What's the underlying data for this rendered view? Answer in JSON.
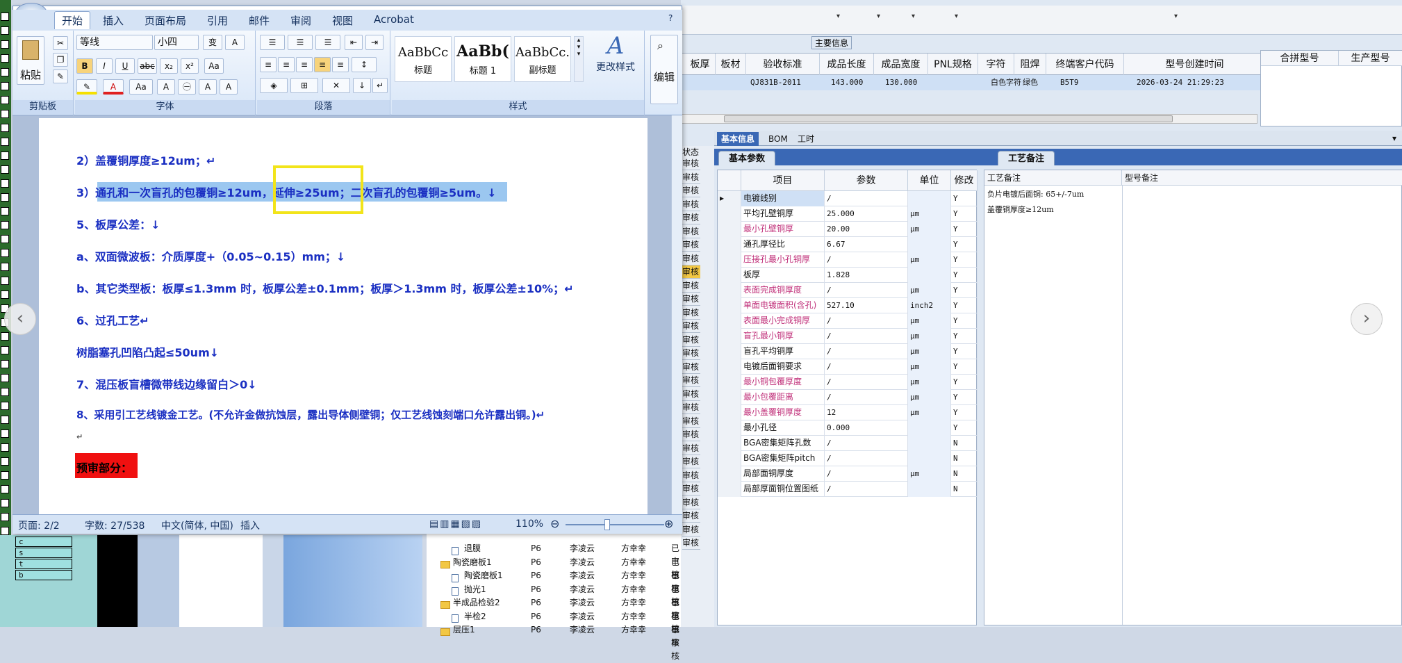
{
  "word": {
    "tabs": [
      "开始",
      "插入",
      "页面布局",
      "引用",
      "邮件",
      "审阅",
      "视图",
      "Acrobat"
    ],
    "font_name": "等线",
    "font_size": "小四",
    "groups": {
      "clipboard": "剪贴板",
      "font": "字体",
      "paragraph": "段落",
      "styles": "样式"
    },
    "paste_label": "粘贴",
    "styles": [
      {
        "preview": "AaBbCc",
        "name": "标题"
      },
      {
        "preview": "AaBb(",
        "name": "标题 1"
      },
      {
        "preview": "AaBbCc.",
        "name": "副标题"
      }
    ],
    "change_styles": "更改样式",
    "edit_label": "编辑",
    "doc_lines": [
      "2）盖覆铜厚度≥12um；↵",
      "3）通孔和一次盲孔的包覆铜≥12um，延伸≥25um；二次盲孔的包覆铜≥5um。↓",
      "5、板厚公差：↓",
      "a、双面微波板：介质厚度+（0.05~0.15）mm；↓",
      "b、其它类型板：板厚≤1.3mm 时，板厚公差±0.1mm；板厚＞1.3mm 时，板厚公差±10%；↵",
      "6、过孔工艺↵",
      "树脂塞孔凹陷凸起≤50um↓",
      "7、混压板盲槽微带线边缘留白＞0↓",
      "8、采用引工艺线镀金工艺。(不允许金做抗蚀层，露出导体侧壁铜；仅工艺线蚀刻端口允许露出铜。)↵",
      "↵"
    ],
    "red_line": "预审部分：",
    "status": {
      "page": "页面: 2/2",
      "words": "字数: 27/538",
      "lang": "中文(简体, 中国)",
      "mode": "插入",
      "zoom": "110%"
    }
  },
  "main_info_label": "主要信息",
  "grid": {
    "headers": [
      "板厚",
      "板材",
      "验收标准",
      "成品长度",
      "成品宽度",
      "PNL规格",
      "字符",
      "阻焊",
      "终端客户代码",
      "型号创建时间"
    ],
    "row": [
      "",
      "",
      "QJ831B-2011",
      "143.000",
      "130.000",
      "",
      "白色字符",
      "绿色",
      "B5T9",
      "2026-03-24 21:29:23"
    ],
    "side_headers": [
      "合拼型号",
      "生产型号"
    ]
  },
  "tabs": [
    "基本信息",
    "BOM",
    "工时"
  ],
  "subtabs": {
    "left": "基本参数",
    "right": "工艺备注"
  },
  "param_table": {
    "headers": [
      "项目",
      "参数",
      "单位",
      "修改"
    ],
    "rows": [
      {
        "item": "电镀线别",
        "value": "/",
        "unit": "",
        "mod": "Y",
        "pink": false
      },
      {
        "item": "平均孔壁铜厚",
        "value": "25.000",
        "unit": "μm",
        "mod": "Y",
        "pink": false
      },
      {
        "item": "最小孔壁铜厚",
        "value": "20.00",
        "unit": "μm",
        "mod": "Y",
        "pink": true
      },
      {
        "item": "通孔厚径比",
        "value": "6.67",
        "unit": "",
        "mod": "Y",
        "pink": false
      },
      {
        "item": "压接孔最小孔铜厚",
        "value": "/",
        "unit": "μm",
        "mod": "Y",
        "pink": true
      },
      {
        "item": "板厚",
        "value": "1.828",
        "unit": "",
        "mod": "Y",
        "pink": false
      },
      {
        "item": "表面完成铜厚度",
        "value": "/",
        "unit": "μm",
        "mod": "Y",
        "pink": true
      },
      {
        "item": "单面电镀面积(含孔)",
        "value": "527.10",
        "unit": "inch2",
        "mod": "Y",
        "pink": true
      },
      {
        "item": "表面最小完成铜厚",
        "value": "/",
        "unit": "μm",
        "mod": "Y",
        "pink": true
      },
      {
        "item": "盲孔最小铜厚",
        "value": "/",
        "unit": "μm",
        "mod": "Y",
        "pink": true
      },
      {
        "item": "盲孔平均铜厚",
        "value": "/",
        "unit": "μm",
        "mod": "Y",
        "pink": false
      },
      {
        "item": "电镀后面铜要求",
        "value": "/",
        "unit": "μm",
        "mod": "Y",
        "pink": false
      },
      {
        "item": "最小铜包覆厚度",
        "value": "/",
        "unit": "μm",
        "mod": "Y",
        "pink": true
      },
      {
        "item": "最小包覆距离",
        "value": "/",
        "unit": "μm",
        "mod": "Y",
        "pink": true
      },
      {
        "item": "最小盖覆铜厚度",
        "value": "12",
        "unit": "μm",
        "mod": "Y",
        "pink": true
      },
      {
        "item": "最小孔径",
        "value": "0.000",
        "unit": "",
        "mod": "Y",
        "pink": false
      },
      {
        "item": "BGA密集矩阵孔数",
        "value": "/",
        "unit": "",
        "mod": "N",
        "pink": false
      },
      {
        "item": "BGA密集矩阵pitch",
        "value": "/",
        "unit": "",
        "mod": "N",
        "pink": false
      },
      {
        "item": "局部面铜厚度",
        "value": "/",
        "unit": "μm",
        "mod": "N",
        "pink": false
      },
      {
        "item": "局部厚面铜位置图纸",
        "value": "/",
        "unit": "",
        "mod": "N",
        "pink": false
      }
    ]
  },
  "notes": {
    "headers": [
      "工艺备注",
      "型号备注"
    ],
    "lines": [
      "负片电镀后面铜: 65+/-7um",
      "盖覆铜厚度≥12um"
    ]
  },
  "mid_col_label": "状态",
  "mid_col_items": [
    "审核",
    "审核",
    "审核",
    "审核",
    "审核",
    "审核",
    "审核",
    "审核",
    "审核",
    "审核",
    "审核",
    "审核",
    "审核",
    "审核",
    "审核",
    "审核",
    "审核",
    "审核",
    "审核",
    "审核",
    "审核",
    "审核",
    "审核",
    "审核",
    "审核",
    "审核",
    "审核",
    "审核",
    "审核"
  ],
  "tree": [
    {
      "name": "退膜",
      "c1": "P6",
      "c2": "李凌云",
      "c3": "方幸幸",
      "c4": "已审核",
      "level": 2
    },
    {
      "name": "陶瓷磨板1",
      "c1": "P6",
      "c2": "李凌云",
      "c3": "方幸幸",
      "c4": "已审核",
      "level": 1
    },
    {
      "name": "陶瓷磨板1",
      "c1": "P6",
      "c2": "李凌云",
      "c3": "方幸幸",
      "c4": "已审核",
      "level": 2
    },
    {
      "name": "抛光1",
      "c1": "P6",
      "c2": "李凌云",
      "c3": "方幸幸",
      "c4": "已审核",
      "level": 2
    },
    {
      "name": "半成品检验2",
      "c1": "P6",
      "c2": "李凌云",
      "c3": "方幸幸",
      "c4": "已审核",
      "level": 1
    },
    {
      "name": "半检2",
      "c1": "P6",
      "c2": "李凌云",
      "c3": "方幸幸",
      "c4": "已审核",
      "level": 2
    },
    {
      "name": "层压1",
      "c1": "P6",
      "c2": "李凌云",
      "c3": "方幸幸",
      "c4": "已审核",
      "level": 1
    }
  ],
  "bottom_left_rows": [
    "c",
    "s",
    "t",
    "b"
  ],
  "nav": {
    "prev": "‹",
    "next": "›"
  }
}
